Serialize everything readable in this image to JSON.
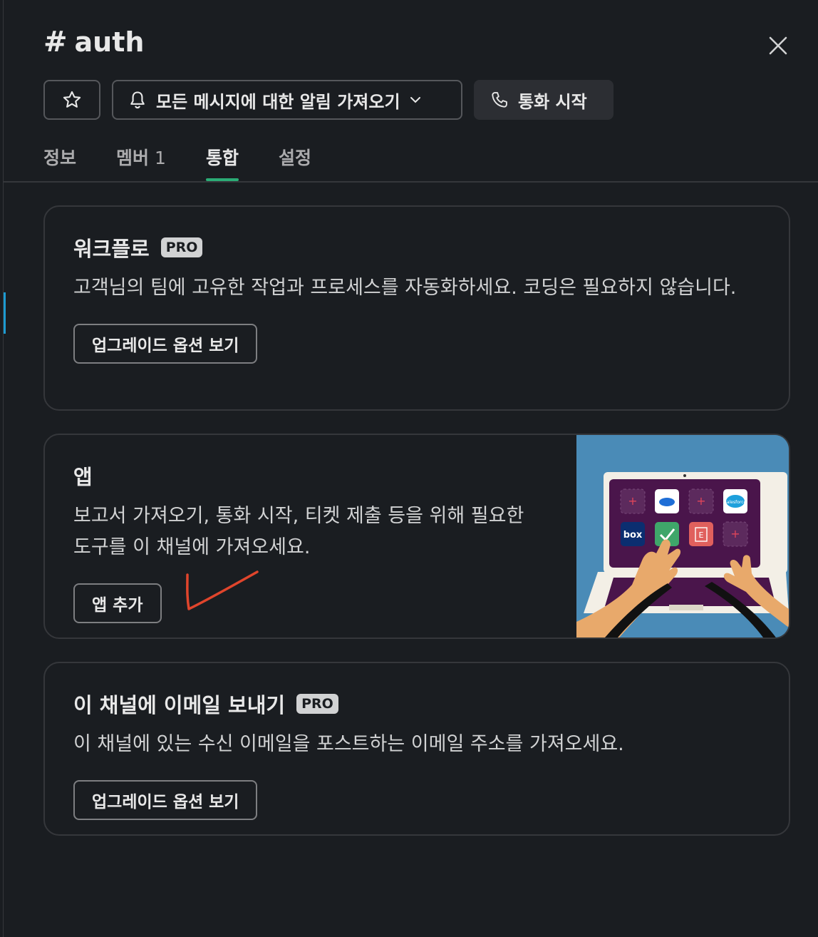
{
  "channel": {
    "hash": "#",
    "name": "auth"
  },
  "actions": {
    "notify_label": "모든 메시지에 대한 알림 가져오기",
    "call_label": "통화 시작"
  },
  "tabs": [
    {
      "label": "정보"
    },
    {
      "label": "멤버",
      "count": "1"
    },
    {
      "label": "통합"
    },
    {
      "label": "설정"
    }
  ],
  "workflow": {
    "title": "워크플로",
    "badge": "PRO",
    "desc": "고객님의 팀에 고유한 작업과 프로세스를 자동화하세요. 코딩은 필요하지 않습니다.",
    "button": "업그레이드 옵션 보기"
  },
  "apps": {
    "title": "앱",
    "desc": "보고서 가져오기, 통화 시작, 티켓 제출 등을 위해 필요한 도구를 이 채널에 가져오세요.",
    "button": "앱 추가",
    "illustration_labels": {
      "box": "box",
      "e": "E",
      "salesforce": "salesforce"
    }
  },
  "email": {
    "title": "이 채널에 이메일 보내기",
    "badge": "PRO",
    "desc": "이 채널에 있는 수신 이메일을 포스트하는 이메일 주소를 가져오세요.",
    "button": "업그레이드 옵션 보기"
  },
  "colors": {
    "background": "#1a1d21",
    "active_tab_underline": "#2bac76",
    "illustration_bg": "#4a8bb7",
    "laptop_screen": "#4a154b",
    "annotation": "#e0452c"
  },
  "icons": [
    "star-icon",
    "bell-icon",
    "chevron-down-icon",
    "phone-icon",
    "close-icon"
  ]
}
